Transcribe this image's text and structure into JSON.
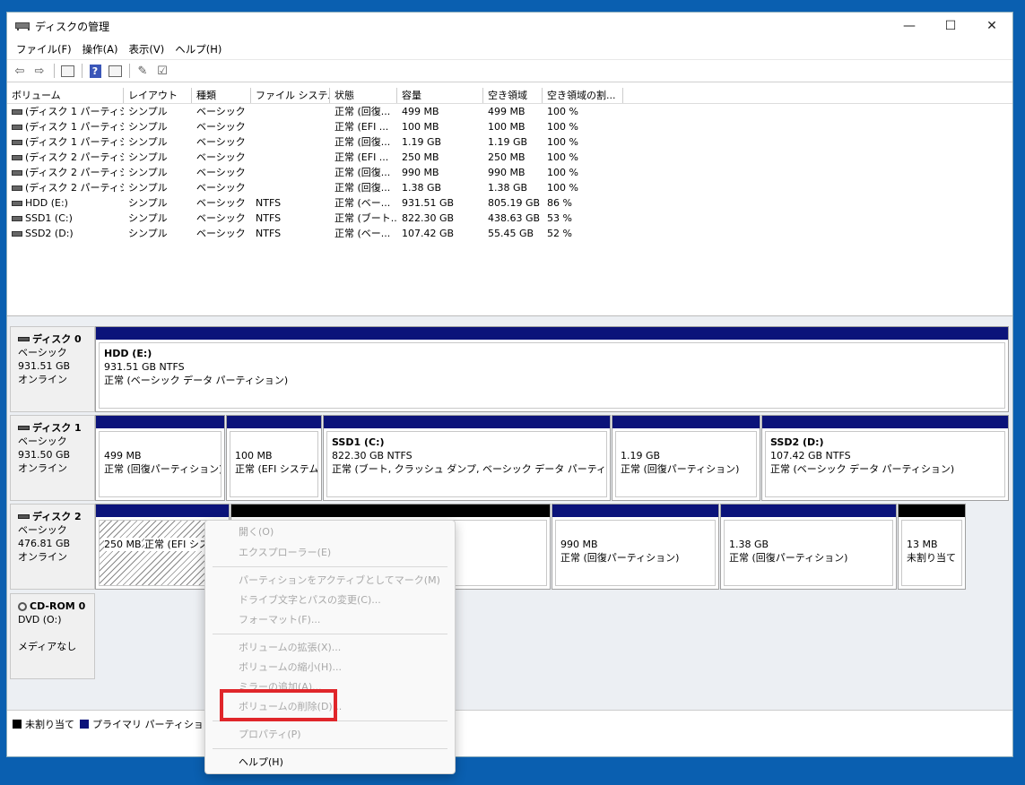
{
  "window": {
    "title": "ディスクの管理",
    "controls": {
      "minimize": "—",
      "maximize": "☐",
      "close": "✕"
    }
  },
  "menubar": [
    "ファイル(F)",
    "操作(A)",
    "表示(V)",
    "ヘルプ(H)"
  ],
  "toolbar": {
    "help_glyph": "?",
    "icons": [
      "back-arrow-icon",
      "forward-arrow-icon",
      "disk-list-icon",
      "help-icon",
      "properties-icon",
      "connect-icon",
      "checklist-icon"
    ]
  },
  "volume_table": {
    "columns": [
      "ボリューム",
      "レイアウト",
      "種類",
      "ファイル システム",
      "状態",
      "容量",
      "空き領域",
      "空き領域の割..."
    ],
    "rows": [
      [
        "(ディスク 1 パーティシ...",
        "シンプル",
        "ベーシック",
        "",
        "正常 (回復...",
        "499 MB",
        "499 MB",
        "100 %"
      ],
      [
        "(ディスク 1 パーティシ...",
        "シンプル",
        "ベーシック",
        "",
        "正常 (EFI ...",
        "100 MB",
        "100 MB",
        "100 %"
      ],
      [
        "(ディスク 1 パーティシ...",
        "シンプル",
        "ベーシック",
        "",
        "正常 (回復...",
        "1.19 GB",
        "1.19 GB",
        "100 %"
      ],
      [
        "(ディスク 2 パーティシ...",
        "シンプル",
        "ベーシック",
        "",
        "正常 (EFI ...",
        "250 MB",
        "250 MB",
        "100 %"
      ],
      [
        "(ディスク 2 パーティシ...",
        "シンプル",
        "ベーシック",
        "",
        "正常 (回復...",
        "990 MB",
        "990 MB",
        "100 %"
      ],
      [
        "(ディスク 2 パーティシ...",
        "シンプル",
        "ベーシック",
        "",
        "正常 (回復...",
        "1.38 GB",
        "1.38 GB",
        "100 %"
      ],
      [
        "HDD (E:)",
        "シンプル",
        "ベーシック",
        "NTFS",
        "正常 (ベー...",
        "931.51 GB",
        "805.19 GB",
        "86 %"
      ],
      [
        "SSD1 (C:)",
        "シンプル",
        "ベーシック",
        "NTFS",
        "正常 (ブート...",
        "822.30 GB",
        "438.63 GB",
        "53 %"
      ],
      [
        "SSD2 (D:)",
        "シンプル",
        "ベーシック",
        "NTFS",
        "正常 (ベー...",
        "107.42 GB",
        "55.45 GB",
        "52 %"
      ]
    ]
  },
  "disks": {
    "disk0": {
      "name": "ディスク 0",
      "type": "ベーシック",
      "size": "931.51 GB",
      "status": "オンライン",
      "partitions": [
        {
          "name": "HDD  (E:)",
          "size": "931.51 GB NTFS",
          "status": "正常 (ベーシック データ パーティション)"
        }
      ]
    },
    "disk1": {
      "name": "ディスク 1",
      "type": "ベーシック",
      "size": "931.50 GB",
      "status": "オンライン",
      "partitions": [
        {
          "name": "",
          "size": "499 MB",
          "status": "正常 (回復パーティション)"
        },
        {
          "name": "",
          "size": "100 MB",
          "status": "正常 (EFI システム パ"
        },
        {
          "name": "SSD1  (C:)",
          "size": "822.30 GB NTFS",
          "status": "正常 (ブート, クラッシュ ダンプ, ベーシック データ パーティション)"
        },
        {
          "name": "",
          "size": "1.19 GB",
          "status": "正常 (回復パーティション)"
        },
        {
          "name": "SSD2  (D:)",
          "size": "107.42 GB NTFS",
          "status": "正常 (ベーシック データ パーティション)"
        }
      ]
    },
    "disk2": {
      "name": "ディスク 2",
      "type": "ベーシック",
      "size": "476.81 GB",
      "status": "オンライン",
      "partitions": [
        {
          "name": "",
          "size": "250 MB",
          "status": "正常 (EFI システム パーティション)"
        },
        {
          "name": "",
          "size": "",
          "status": ""
        },
        {
          "name": "",
          "size": "990 MB",
          "status": "正常 (回復パーティション)"
        },
        {
          "name": "",
          "size": "1.38 GB",
          "status": "正常 (回復パーティション)"
        },
        {
          "name": "",
          "size": "13 MB",
          "status": "未割り当て"
        }
      ]
    },
    "cdrom0": {
      "name": "CD-ROM 0",
      "drive": "DVD (O:)",
      "media": "メディアなし"
    }
  },
  "legend": {
    "unallocated": "未割り当て",
    "primary": "プライマリ パーティション",
    "unallocated_color": "#000000",
    "primary_color": "#0b137a"
  },
  "context_menu": {
    "items": [
      {
        "label": "開く(O)",
        "enabled": false
      },
      {
        "label": "エクスプローラー(E)",
        "enabled": false
      },
      {
        "label": "パーティションをアクティブとしてマーク(M)",
        "enabled": false
      },
      {
        "label": "ドライブ文字とパスの変更(C)...",
        "enabled": false
      },
      {
        "label": "フォーマット(F)...",
        "enabled": false
      },
      {
        "label": "ボリュームの拡張(X)...",
        "enabled": false
      },
      {
        "label": "ボリュームの縮小(H)...",
        "enabled": false
      },
      {
        "label": "ミラーの追加(A)...",
        "enabled": false
      },
      {
        "label": "ボリュームの削除(D)...",
        "enabled": false,
        "highlighted": true
      },
      {
        "label": "プロパティ(P)",
        "enabled": false
      },
      {
        "label": "ヘルプ(H)",
        "enabled": true
      }
    ],
    "highlight_color": "#e0262a"
  }
}
